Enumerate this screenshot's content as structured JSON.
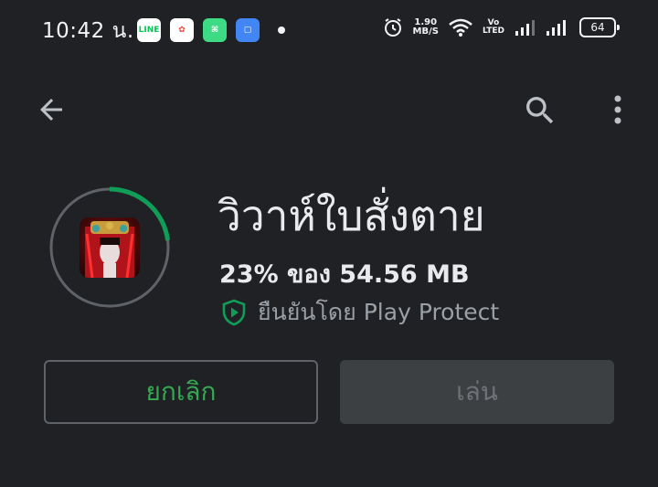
{
  "status_bar": {
    "time": "10:42 น.",
    "notifications": [
      {
        "name": "line-icon",
        "label": "LINE",
        "bg": "#ffffff",
        "fg": "#06c755"
      },
      {
        "name": "photos-icon",
        "label": "✿",
        "bg": "#ffffff",
        "fg": "#ea4335"
      },
      {
        "name": "gift-icon",
        "label": "⌘",
        "bg": "#3ddc84",
        "fg": "#ffffff"
      },
      {
        "name": "files-icon",
        "label": "▢",
        "bg": "#4285f4",
        "fg": "#ffffff"
      }
    ],
    "net_speed_value": "1.90",
    "net_speed_unit": "MB/S",
    "volte_top": "Vo",
    "volte_bottom": "LTED",
    "battery": "64"
  },
  "toolbar": {
    "back_icon": "arrow-left-icon",
    "search_icon": "search-icon",
    "more_icon": "more-vertical-icon"
  },
  "app": {
    "title": "วิวาห์ใบสั่งตาย",
    "progress_text": "23% ของ 54.56 MB",
    "progress_percent": 23,
    "protect_text": "ยืนยันโดย Play Protect"
  },
  "buttons": {
    "cancel_label": "ยกเลิก",
    "play_label": "เล่น"
  },
  "colors": {
    "background": "#202124",
    "accent_green": "#34a853",
    "progress_green": "#0f9d58",
    "ring_track": "#5f6368"
  }
}
